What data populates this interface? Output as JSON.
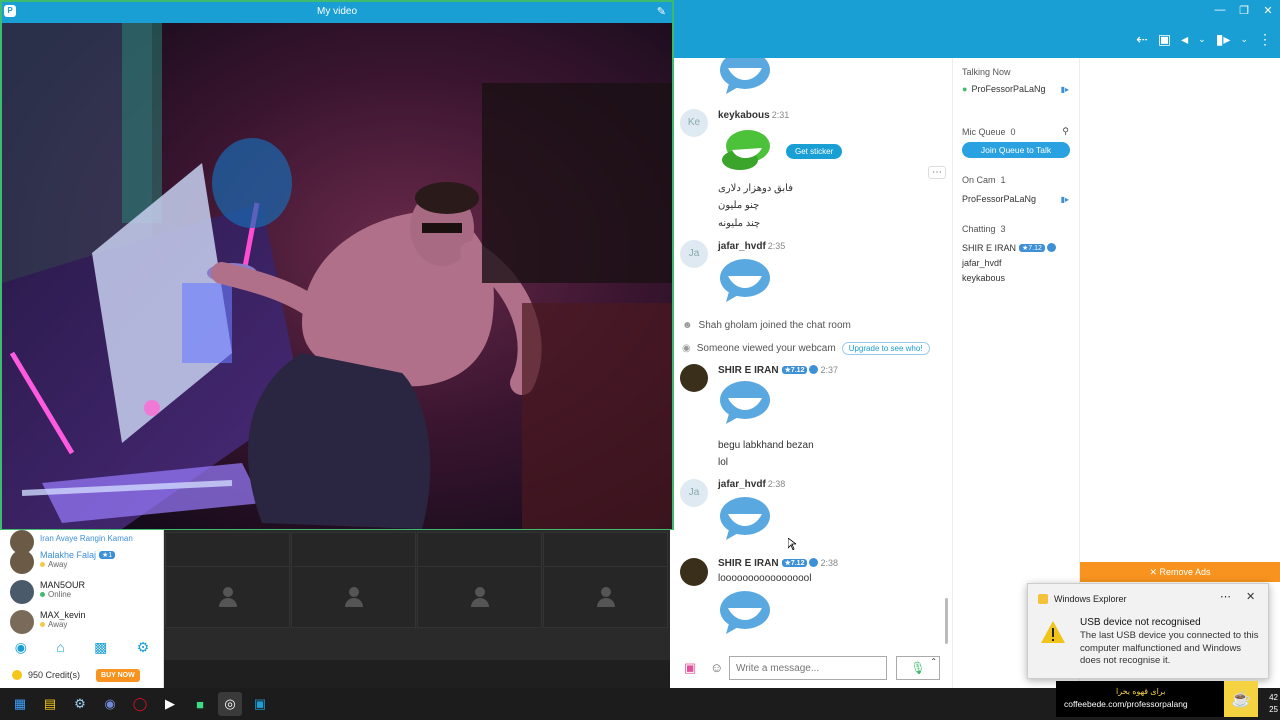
{
  "video_window": {
    "title": "My video",
    "logo": "logo",
    "edit_icon": "edit-icon"
  },
  "toolbar": {
    "icons": [
      "share-icon",
      "gift-icon",
      "megaphone-icon",
      "chevron-down-icon",
      "camera-icon",
      "chevron-down-icon",
      "more-icon"
    ]
  },
  "window_controls": {
    "icons": [
      "minimize-icon",
      "restore-icon",
      "close-icon"
    ]
  },
  "left_list": {
    "items": [
      {
        "name": "Iran Avaye Rangin Kaman",
        "status": ""
      },
      {
        "name": "Malakhe Falaj",
        "badge": "★1",
        "status": "Away",
        "status_color": "#f2c94c"
      },
      {
        "name": "MAN5OUR",
        "status": "Online",
        "status_color": "#3dbb6f"
      },
      {
        "name": "MAX_kevin",
        "status": "Away",
        "status_color": "#f2c94c"
      }
    ],
    "nav_icons": [
      "compass-icon",
      "home-icon",
      "chart-icon",
      "settings-icon"
    ],
    "credits": "950 Credit(s)",
    "buy_now": "BUY NOW"
  },
  "chat": {
    "messages": [
      {
        "user": "keykabous",
        "initials": "Ke",
        "time": "2:31",
        "get_sticker": "Get sticker",
        "lines": [
          "فابق دوهزار دلاری",
          "چنو ملیون",
          "چند ملیونه"
        ]
      },
      {
        "user": "jafar_hvdf",
        "initials": "Ja",
        "time": "2:35"
      },
      {
        "user": "SHIR E IRAN",
        "badge": "★7.12",
        "time": "2:37",
        "lines": [
          "begu labkhand bezan",
          "lol"
        ]
      },
      {
        "user": "jafar_hvdf",
        "initials": "Ja",
        "time": "2:38"
      },
      {
        "user": "SHIR E IRAN",
        "badge": "★7.12",
        "time": "2:38",
        "lines": [
          "looooooooooooooool"
        ]
      }
    ],
    "system": {
      "joined": "Shah gholam joined the chat room",
      "viewed": "Someone viewed your webcam",
      "upgrade": "Upgrade to see who!"
    },
    "composer_placeholder": "Write a message..."
  },
  "users_panel": {
    "talking_now": "Talking Now",
    "talking_user": "ProFessorPaLaNg",
    "mic_queue": "Mic Queue",
    "mic_queue_count": "0",
    "join_queue": "Join Queue to Talk",
    "on_cam": "On Cam",
    "on_cam_count": "1",
    "on_cam_user": "ProFessorPaLaNg",
    "chatting": "Chatting",
    "chatting_count": "3",
    "chatting_users": [
      "SHIR E IRAN",
      "jafar_hvdf",
      "keykabous"
    ],
    "chatting_badge": "★7.12"
  },
  "ads": {
    "remove": "✕ Remove Ads"
  },
  "toast": {
    "app": "Windows Explorer",
    "title": "USB device not recognised",
    "body": "The last USB device you connected to this computer malfunctioned and Windows does not recognise it."
  },
  "overlay": {
    "top_text": "برای قهوه بخرا",
    "url": "coffeebede.com/professorpalang"
  },
  "taskbar": {
    "icons": [
      "windows-icon",
      "file-explorer-icon",
      "steam-icon",
      "discord-icon",
      "opera-icon",
      "media-player-icon",
      "android-icon",
      "app-icon",
      "paltalk-icon"
    ],
    "clock_top": "42",
    "clock_bottom": "25"
  },
  "colors": {
    "accent": "#1a9fd5",
    "green": "#3dbb6f",
    "orange": "#f7931e"
  }
}
